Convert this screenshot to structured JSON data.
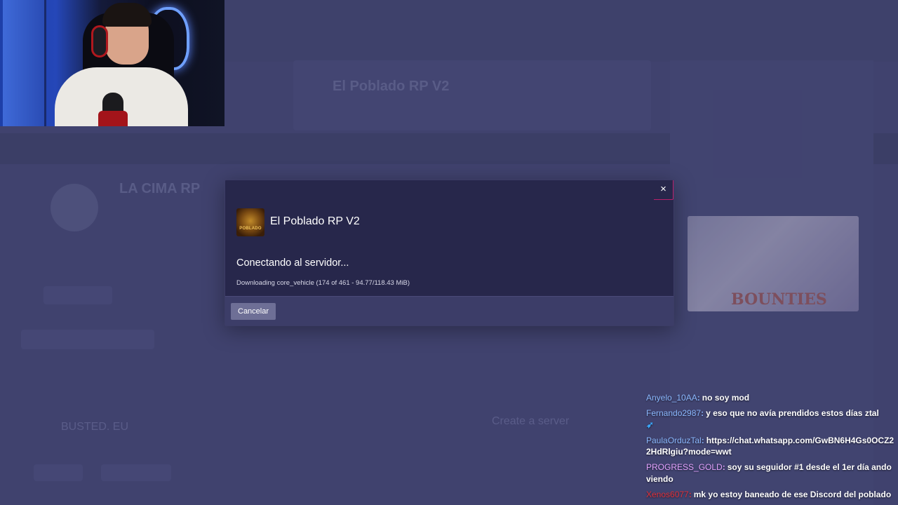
{
  "background": {
    "hero_title": "El Poblado RP V2",
    "server_title": "LA CIMA RP",
    "busted_title": "BUSTED. EU",
    "create_title": "Create a server",
    "image_text": "BOUNTIES"
  },
  "modal": {
    "close_label": "×",
    "server_name": "El Poblado RP V2",
    "logo_text": "POBLADO",
    "status": "Conectando al servidor...",
    "progress": "Downloading core_vehicle (174 of 461 - 94.77/118.43 MiB)",
    "cancel_label": "Cancelar"
  },
  "chat": {
    "messages": [
      {
        "user": "Anyelo_10AA",
        "color": "#8bb8ff",
        "text": "no soy mod"
      },
      {
        "user": "Fernando2987",
        "color": "#8bb8ff",
        "text": "y eso que no avía prendidos estos días ztal"
      },
      {
        "user": "PaulaOrduzTal",
        "color": "#8bb8ff",
        "text": "https://chat.whatsapp.com/GwBN6H4Gs0OCZ22HdRlgiu?mode=wwt"
      },
      {
        "user": "PROGRESS_GOLD",
        "color": "#e3a2ff",
        "text": "soy su seguidor #1 desde el 1er día ando viendo"
      },
      {
        "user": "Xenos6077",
        "color": "#e0303a",
        "text": "mk yo estoy baneado de ese Discord del poblado"
      }
    ]
  }
}
